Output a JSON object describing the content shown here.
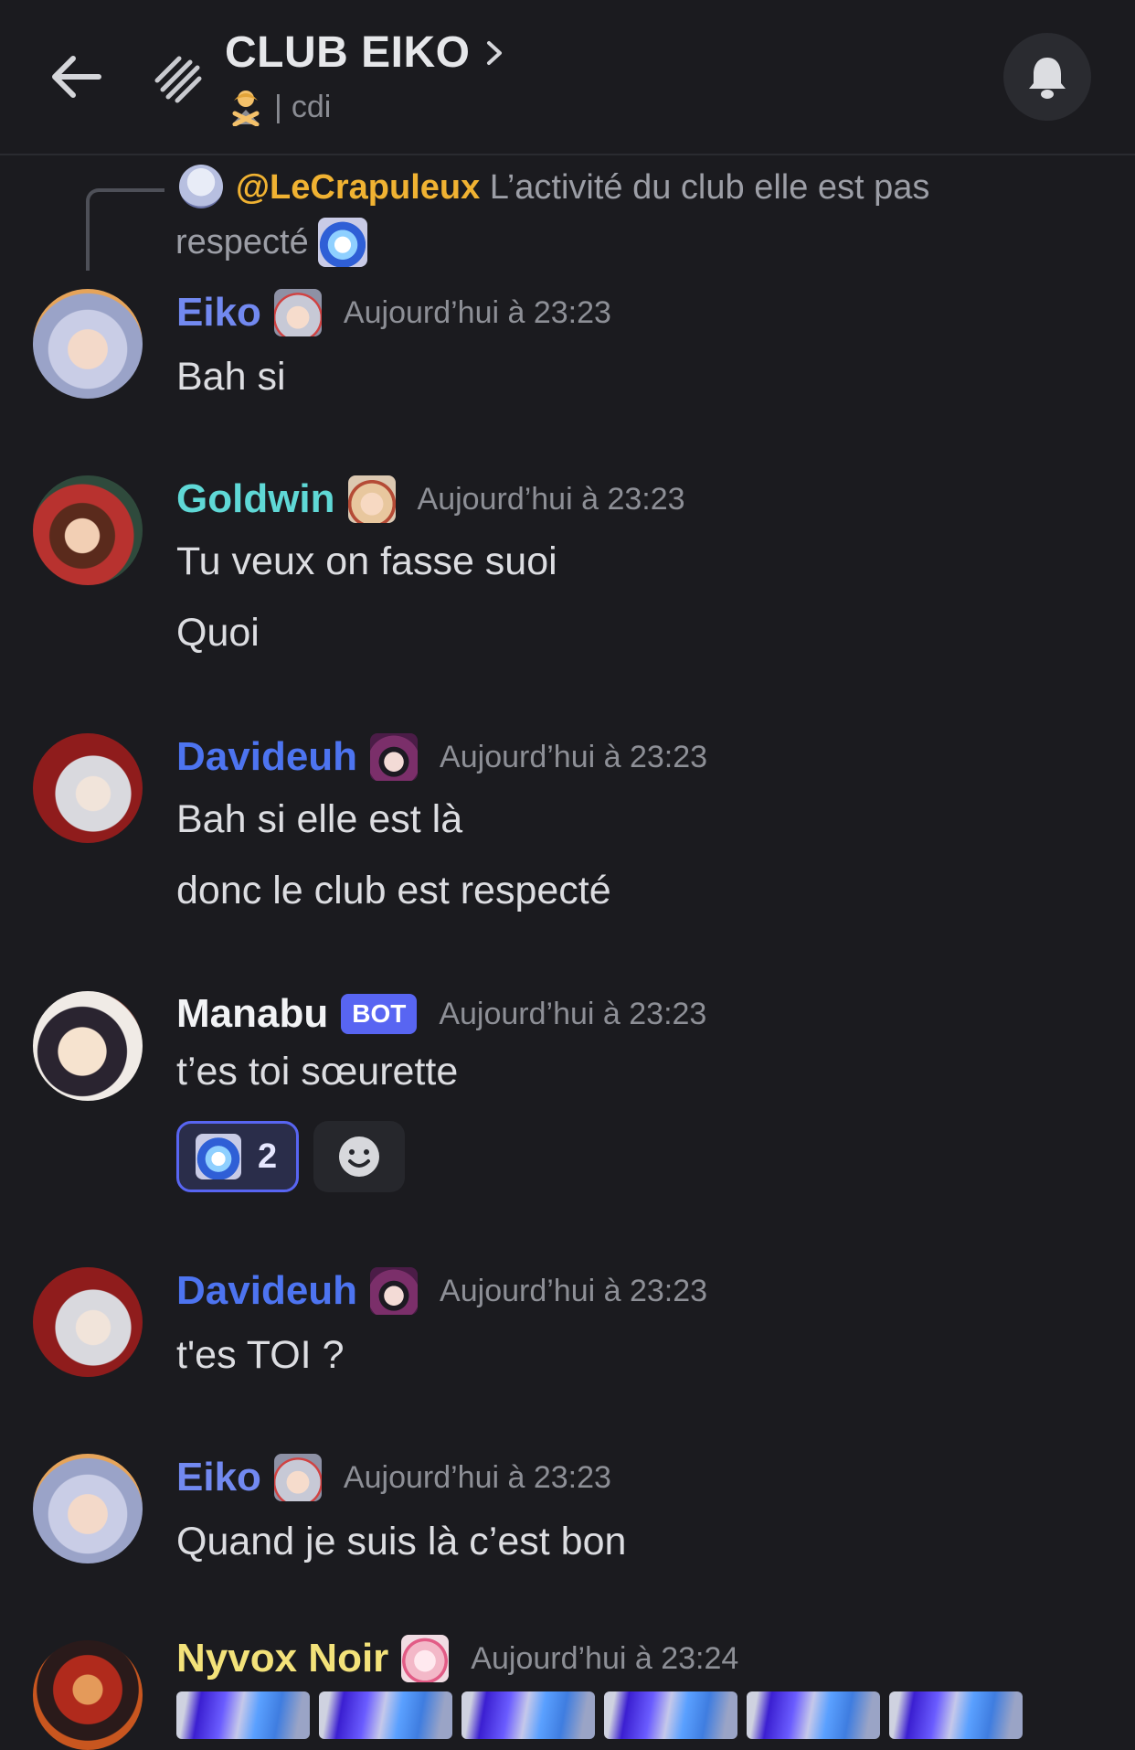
{
  "header": {
    "title": "CLUB EIKO",
    "subtitle_separator": "|",
    "subtitle": "cdi"
  },
  "reply": {
    "mention": "@LeCrapuleux",
    "text_line1": "L’activité du club elle est pas",
    "text_line2": "respecté"
  },
  "messages": [
    {
      "username": "Eiko",
      "username_color": "#7289f0",
      "timestamp": "Aujourd’hui à 23:23",
      "lines": [
        "Bah si"
      ]
    },
    {
      "username": "Goldwin",
      "username_color": "#5fd8d6",
      "timestamp": "Aujourd’hui à 23:23",
      "lines": [
        "Tu veux on fasse suoi",
        "Quoi"
      ]
    },
    {
      "username": "Davideuh",
      "username_color": "#4d74f0",
      "timestamp": "Aujourd’hui à 23:23",
      "lines": [
        "Bah si elle est là",
        "donc le club est respecté"
      ]
    },
    {
      "username": "Manabu",
      "username_color": "#f2f3f5",
      "bot_tag": "BOT",
      "timestamp": "Aujourd’hui à 23:23",
      "lines": [
        "t’es toi sœurette"
      ],
      "reaction_count": "2"
    },
    {
      "username": "Davideuh",
      "username_color": "#4d74f0",
      "timestamp": "Aujourd’hui à 23:23",
      "lines": [
        "t'es TOI ?"
      ]
    },
    {
      "username": "Eiko",
      "username_color": "#7289f0",
      "timestamp": "Aujourd’hui à 23:23",
      "lines": [
        "Quand je suis là c’est bon"
      ]
    },
    {
      "username": "Nyvox Noir",
      "username_color": "#f3e27a",
      "timestamp": "Aujourd’hui à 23:24",
      "lines": []
    }
  ],
  "icons": {
    "back": "arrow-left-icon",
    "channel": "forum-thread-icon",
    "bell": "bell-icon",
    "chevron": "chevron-right-icon",
    "add_reaction": "smiley-icon"
  },
  "colors": {
    "background": "#1b1b1f",
    "accent": "#5865f2",
    "mention": "#f0b232"
  }
}
